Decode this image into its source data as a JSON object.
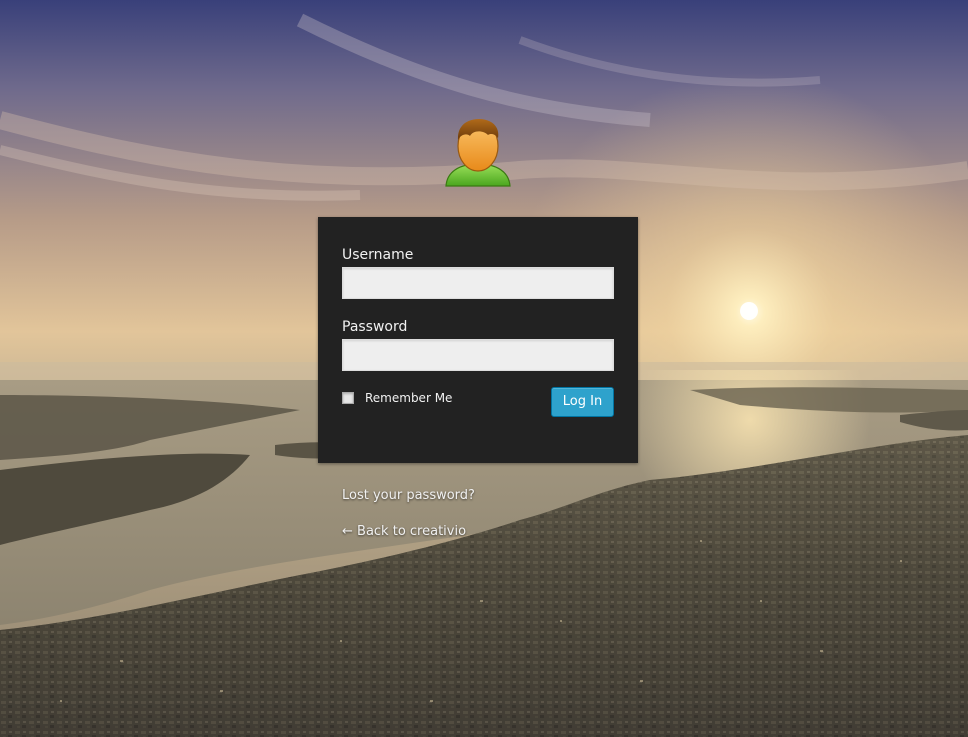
{
  "form": {
    "username_label": "Username",
    "username_value": "",
    "password_label": "Password",
    "password_value": "",
    "remember_label": "Remember Me",
    "remember_checked": false,
    "submit_label": "Log In"
  },
  "links": {
    "lost_password": "Lost your password?",
    "back_to_site": "← Back to creativio"
  },
  "icons": {
    "logo": "user-avatar-icon",
    "checkbox": "checkbox-unchecked"
  },
  "colors": {
    "login_box_bg": "#222222",
    "input_bg": "#eeeeee",
    "button_bg": "#2ea2cc",
    "text": "#f1f1f1"
  }
}
